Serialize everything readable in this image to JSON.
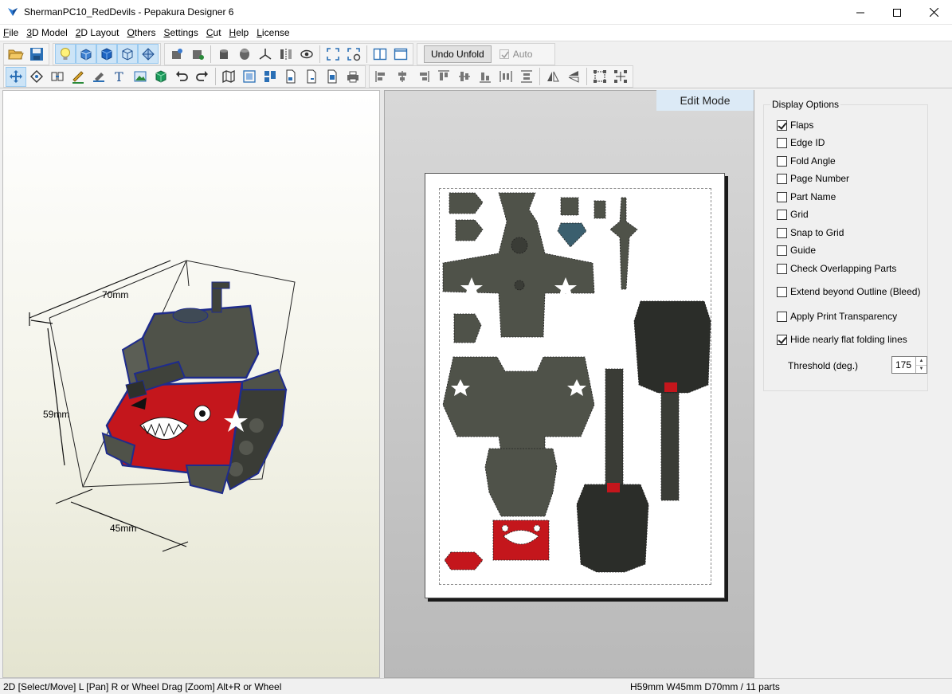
{
  "window": {
    "title": "ShermanPC10_RedDevils - Pepakura Designer 6"
  },
  "menu": [
    {
      "underline": "F",
      "rest": "ile"
    },
    {
      "underline": "3",
      "rest": "D Model"
    },
    {
      "underline": "2",
      "rest": "D Layout"
    },
    {
      "underline": "O",
      "rest": "thers"
    },
    {
      "underline": "S",
      "rest": "ettings"
    },
    {
      "underline": "C",
      "rest": "ut"
    },
    {
      "underline": "H",
      "rest": "elp"
    },
    {
      "underline": "L",
      "rest": "icense"
    }
  ],
  "toolbar": {
    "undo_unfold_label": "Undo Unfold",
    "auto_label": "Auto",
    "auto_checked": true,
    "auto_enabled": false
  },
  "view3d": {
    "dim_width": "70mm",
    "dim_height": "59mm",
    "dim_depth": "45mm"
  },
  "view2d": {
    "edit_mode_label": "Edit Mode"
  },
  "display_options": {
    "title": "Display Options",
    "items": [
      {
        "label": "Flaps",
        "checked": true
      },
      {
        "label": "Edge ID",
        "checked": false
      },
      {
        "label": "Fold Angle",
        "checked": false
      },
      {
        "label": "Page Number",
        "checked": false
      },
      {
        "label": "Part Name",
        "checked": false
      },
      {
        "label": "Grid",
        "checked": false
      },
      {
        "label": "Snap to Grid",
        "checked": false
      },
      {
        "label": "Guide",
        "checked": false
      },
      {
        "label": "Check Overlapping Parts",
        "checked": false
      },
      {
        "label": "Extend beyond Outline (Bleed)",
        "checked": false
      },
      {
        "label": "Apply Print Transparency",
        "checked": false
      },
      {
        "label": "Hide nearly flat folding lines",
        "checked": true
      }
    ],
    "threshold_label": "Threshold (deg.)",
    "threshold_value": "175"
  },
  "status": {
    "left": "2D [Select/Move] L [Pan] R or Wheel Drag [Zoom] Alt+R or Wheel",
    "right": "H59mm W45mm D70mm / 11 parts"
  },
  "colors": {
    "accent": "#0078d7",
    "tank_body": "#4f5249",
    "tank_red": "#c4161c",
    "edit_mode_bg": "#dceaf6"
  }
}
